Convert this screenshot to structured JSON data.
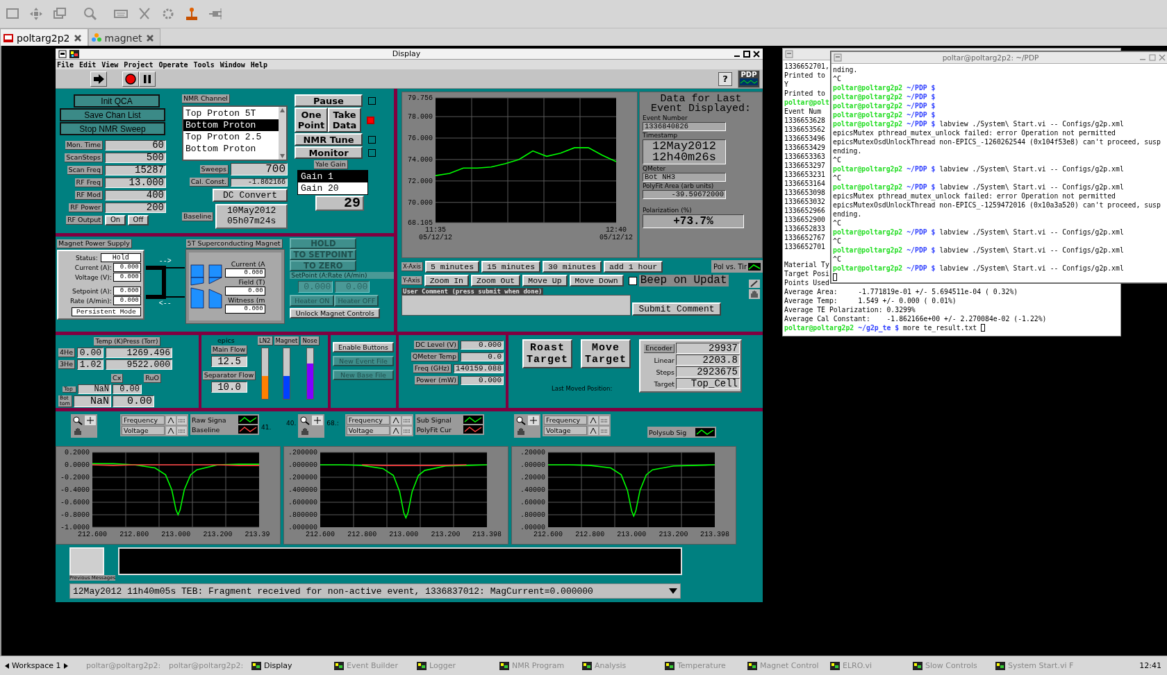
{
  "tabs": [
    {
      "label": "poltarg2p2",
      "selected": true
    },
    {
      "label": "magnet",
      "selected": false
    }
  ],
  "display": {
    "title": "Display",
    "menu": [
      "File",
      "Edit",
      "View",
      "Project",
      "Operate",
      "Tools",
      "Window",
      "Help"
    ],
    "help": "?",
    "logo": "PDP",
    "nmr": {
      "buttons": [
        "Init QCA",
        "Save Chan List",
        "Stop NMR Sweep"
      ],
      "settings": [
        {
          "label": "Mon. Time",
          "value": "60"
        },
        {
          "label": "ScanSteps",
          "value": "500"
        },
        {
          "label": "Scan Freq",
          "value": "15287"
        },
        {
          "label": "RF Freq",
          "value": "13.000"
        },
        {
          "label": "RF Mod",
          "value": "400"
        },
        {
          "label": "RF Power",
          "value": "200"
        }
      ],
      "rf_output": {
        "label": "RF Output",
        "buttons": [
          "On",
          "Off"
        ]
      },
      "channel_label": "NMR Channel",
      "channels": [
        {
          "label": "Top Proton 5T",
          "selected": false
        },
        {
          "label": "Bottom Proton",
          "selected": true
        },
        {
          "label": "Top Proton 2.5",
          "selected": false
        },
        {
          "label": "Bottom Proton",
          "selected": false
        }
      ],
      "sweeps": {
        "label": "Sweeps",
        "value": "700"
      },
      "cal_const": {
        "label": "Cal. Const.",
        "value": "-1.862166"
      },
      "dc_convert": "DC Convert",
      "baseline": {
        "label": "Baseline",
        "value": "10May2012\n05h07m24s"
      },
      "actions": [
        {
          "buttons": [
            "Pause"
          ],
          "led_on": false
        },
        {
          "buttons": [
            "One Point",
            "Take Data"
          ],
          "led_on": true
        },
        {
          "buttons": [
            "NMR Tune"
          ],
          "led_on": false
        },
        {
          "buttons": [
            "Monitor"
          ],
          "led_on": false
        }
      ],
      "gain_label": "Yale Gain",
      "gains": [
        {
          "label": "Gain 1",
          "selected": true
        },
        {
          "label": "Gain 20",
          "selected": false
        }
      ],
      "gain_reading": "29"
    },
    "magnet_supply": {
      "label": "Magnet Power Supply",
      "status_label": "Status:",
      "status": "Hold",
      "readings": [
        {
          "label": "Current (A):",
          "value": "0.000"
        },
        {
          "label": "Voltage (V):",
          "value": "0.000"
        },
        {
          "label": "Setpoint (A):",
          "value": "0.000"
        },
        {
          "label": "Rate (A/min):",
          "value": "0.000"
        }
      ],
      "persistent_mode": "Persistent Mode",
      "arrows": [
        "-->",
        "<--"
      ]
    },
    "magnet": {
      "label": "5T Superconducting Magnet",
      "readings": [
        {
          "label": "Current (A",
          "value": "0.000"
        },
        {
          "label": "Field (T)",
          "value": "0.00"
        },
        {
          "label": "Witness (m",
          "value": "0.000"
        }
      ]
    },
    "magnet_controls": {
      "buttons": [
        {
          "label": "HOLD",
          "disabled": true
        },
        {
          "label": "TO SETPOINT",
          "disabled": true
        },
        {
          "label": "TO ZERO",
          "disabled": true
        }
      ],
      "setpoint_label": "SetPoint (A:Rate (A/min)",
      "setpoint_values": [
        "0.000",
        "0.00"
      ],
      "heater_buttons": [
        {
          "label": "Heater ON",
          "disabled": true
        },
        {
          "label": "Heater OFF",
          "disabled": true
        }
      ],
      "unlock": "Unlock Magnet Controls"
    },
    "pol_chart": {
      "chart_data": {
        "type": "line",
        "grid": true,
        "categories": [
          "11:35\n05/12/12",
          null,
          null,
          null,
          null,
          null,
          null,
          null,
          null,
          null,
          null,
          null,
          null,
          "12:40\n05/12/12"
        ],
        "ylim": [
          68.105,
          79.756
        ],
        "yticks": [
          {
            "value": 79.756,
            "label": "79.756"
          },
          {
            "value": 78,
            "label": "78.000"
          },
          {
            "value": 76,
            "label": "76.000"
          },
          {
            "value": 74,
            "label": "74.000"
          },
          {
            "value": 72,
            "label": "72.000"
          },
          {
            "value": 70,
            "label": "70.000"
          },
          {
            "value": 68.105,
            "label": "68.105"
          }
        ],
        "series": [
          {
            "name": "Pol vs. Tir",
            "color": "#00ff00",
            "values": [
              72.5,
              72.7,
              73.2,
              73.2,
              73.3,
              73.6,
              74.0,
              74.8,
              74.3,
              74.6,
              75.1,
              75.1,
              74.4,
              73.8
            ]
          }
        ]
      }
    },
    "x_axis": {
      "label": "X-Axis",
      "buttons": [
        "5 minutes",
        "15 minutes",
        "30 minutes",
        "add 1 hour"
      ]
    },
    "y_axis": {
      "label": "Y-Axis",
      "buttons": [
        "Zoom In",
        "Zoom Out",
        "Move Up",
        "Move Down"
      ]
    },
    "beep": {
      "label": "Beep on Updat",
      "checked": false
    },
    "comment": {
      "label": "User Comment (press submit when done)",
      "submit": "Submit Comment"
    },
    "last_event": {
      "title": "Data for Last Event Displayed:",
      "fields": [
        {
          "label": "Event Number",
          "value": "1336840826",
          "kind": "small"
        },
        {
          "label": "Timestamp",
          "value": "12May2012\n12h40m26s",
          "kind": "large"
        },
        {
          "label": "QMeter",
          "value": "Bot NH3",
          "kind": "small"
        },
        {
          "label": "PolyFit Area (arb units)",
          "value": "-39.59672000",
          "kind": "small"
        },
        {
          "label": "Polarization (%)",
          "value": "+73.7%",
          "kind": "large"
        }
      ]
    },
    "temps": {
      "label": "Temp (K)Press (Torr)",
      "rows": [
        {
          "label": "4He",
          "temp": "0.00",
          "press": "1269.496"
        },
        {
          "label": "3He",
          "temp": "1.02",
          "press": "9522.000"
        }
      ],
      "sensor_labels": [
        "Cx",
        "RuO"
      ],
      "sensors": [
        {
          "label": "Top",
          "cx": "NaN",
          "ruo": "0.00"
        },
        {
          "label": "Bottom",
          "cx": "NaN",
          "ruo": "0.00"
        }
      ]
    },
    "flow": {
      "title": "epics",
      "flows": [
        {
          "label": "Main Flow",
          "value": "12.5"
        },
        {
          "label": "Separator Flow",
          "value": "10.0"
        }
      ],
      "levels": [
        {
          "label": "LN2",
          "level": 0.45,
          "color": "#ff8000"
        },
        {
          "label": "Magnet",
          "level": 0.45,
          "color": "#0040ff"
        },
        {
          "label": "Nose",
          "level": 0.7,
          "color": "#8000ff"
        }
      ]
    },
    "file_buttons": [
      {
        "label": "Enable Buttons",
        "disabled": false
      },
      {
        "label": "New Event File",
        "disabled": true
      },
      {
        "label": "New Base File",
        "disabled": true
      }
    ],
    "microwave": [
      {
        "label": "DC Level (V)",
        "value": "0.000"
      },
      {
        "label": "QMeter Temp",
        "value": "0.0"
      },
      {
        "label": "Freq (GHz)",
        "value": "140159.088"
      },
      {
        "label": "Power (mW)",
        "value": "0.000"
      }
    ],
    "target": {
      "buttons": [
        "Roast Target",
        "Move Target"
      ],
      "caption": "Last Moved Position:",
      "positions": [
        {
          "label": "Encoder",
          "value": "29937"
        },
        {
          "label": "Linear",
          "value": "2203.8"
        },
        {
          "label": "Steps",
          "value": "2923675"
        },
        {
          "label": "Target",
          "value": "Top_Cell"
        }
      ]
    },
    "spectra": [
      {
        "scales": [
          "Frequency",
          "Voltage"
        ],
        "stray_texts": [
          "41."
        ],
        "chart_data": {
          "type": "line",
          "grid": true,
          "x": [
            212.6,
            212.7,
            212.8,
            212.9,
            212.95,
            212.98,
            213.0,
            213.01,
            213.02,
            213.04,
            213.07,
            213.1,
            213.2,
            213.3,
            213.398
          ],
          "xlim": [
            212.6,
            213.398
          ],
          "ylim": [
            -1.0,
            0.2
          ],
          "xticks": [
            {
              "value": 212.6,
              "label": "212.600"
            },
            {
              "value": 212.8,
              "label": "212.800"
            },
            {
              "value": 213.0,
              "label": "213.000"
            },
            {
              "value": 213.2,
              "label": "213.200"
            },
            {
              "value": 213.39,
              "label": "213.39"
            }
          ],
          "yticks": [
            {
              "value": 0.2,
              "label": "0.2000"
            },
            {
              "value": 0,
              "label": "0.0000"
            },
            {
              "value": -0.2,
              "label": "-0.2000"
            },
            {
              "value": -0.4,
              "label": "-0.4000"
            },
            {
              "value": -0.6,
              "label": "-0.6000"
            },
            {
              "value": -0.8,
              "label": "-0.8000"
            },
            {
              "value": -1.0,
              "label": "-1.0000"
            }
          ],
          "series": [
            {
              "name": "Raw Signa",
              "color": "#00ff00",
              "values": [
                0.02,
                0.02,
                0.0,
                -0.05,
                -0.16,
                -0.4,
                -0.72,
                -0.8,
                -0.72,
                -0.4,
                -0.16,
                -0.08,
                0.0,
                0.01,
                0.01
              ]
            },
            {
              "name": "Baseline",
              "color": "#ff4040",
              "values": [
                0.0,
                -0.01,
                0.0,
                0.0,
                0.0,
                0.0,
                0.0,
                0.0,
                0.0,
                0.0,
                0.0,
                0.0,
                0.0,
                -0.01,
                -0.01
              ]
            }
          ]
        }
      },
      {
        "scales": [
          "Frequency",
          "Voltage"
        ],
        "stray_texts": [
          "40.",
          "68.:"
        ],
        "bottom_tick_label": ".000000",
        "chart_data": {
          "type": "line",
          "grid": true,
          "x": [
            212.6,
            212.7,
            212.8,
            212.9,
            212.95,
            212.98,
            213.0,
            213.01,
            213.02,
            213.04,
            213.07,
            213.1,
            213.2,
            213.3,
            213.398
          ],
          "xlim": [
            212.6,
            213.398
          ],
          "ylim": [
            -1.0,
            0.2
          ],
          "xticks": [
            {
              "value": 212.6,
              "label": "212.600"
            },
            {
              "value": 212.8,
              "label": "212.800"
            },
            {
              "value": 213.0,
              "label": "213.000"
            },
            {
              "value": 213.2,
              "label": "213.200"
            },
            {
              "value": 213.398,
              "label": "213.398"
            }
          ],
          "yticks": [
            {
              "value": 0.2,
              "label": ".200000"
            },
            {
              "value": 0,
              "label": ".000000"
            },
            {
              "value": -0.2,
              "label": ".200000"
            },
            {
              "value": -0.4,
              "label": ".400000"
            },
            {
              "value": -0.6,
              "label": ".600000"
            },
            {
              "value": -0.8,
              "label": ".800000"
            }
          ],
          "series": [
            {
              "name": "Sub Signal",
              "color": "#00ff00",
              "values": [
                0.0,
                0.0,
                -0.01,
                -0.06,
                -0.17,
                -0.43,
                -0.77,
                -0.85,
                -0.77,
                -0.43,
                -0.17,
                -0.09,
                -0.02,
                -0.01,
                0.0
              ]
            },
            {
              "name": "PolyFit Cur",
              "color": "#ff4040",
              "values": [
                null,
                null,
                0.0,
                -0.01,
                -0.01,
                -0.01,
                -0.01,
                -0.01,
                -0.01,
                -0.01,
                -0.01,
                -0.01,
                -0.01,
                0.0,
                null
              ]
            }
          ]
        }
      },
      {
        "scales": [
          "Frequency",
          "Voltage"
        ],
        "bottom_tick_label": ".00000",
        "chart_data": {
          "type": "line",
          "grid": true,
          "x": [
            212.6,
            212.7,
            212.8,
            212.9,
            212.95,
            212.98,
            213.0,
            213.01,
            213.02,
            213.04,
            213.07,
            213.1,
            213.2,
            213.3,
            213.398
          ],
          "xlim": [
            212.6,
            213.398
          ],
          "ylim": [
            -1.0,
            0.2
          ],
          "xticks": [
            {
              "value": 212.6,
              "label": "212.600"
            },
            {
              "value": 212.8,
              "label": "212.800"
            },
            {
              "value": 213.0,
              "label": "213.000"
            },
            {
              "value": 213.2,
              "label": "213.200"
            },
            {
              "value": 213.398,
              "label": "213.398"
            }
          ],
          "yticks": [
            {
              "value": 0.2,
              "label": ".20000"
            },
            {
              "value": 0,
              "label": ".00000"
            },
            {
              "value": -0.2,
              "label": ".20000"
            },
            {
              "value": -0.4,
              "label": ".40000"
            },
            {
              "value": -0.6,
              "label": ".60000"
            },
            {
              "value": -0.8,
              "label": ".80000"
            }
          ],
          "series": [
            {
              "name": "Polysub Sig",
              "color": "#00ff00",
              "values": [
                0.0,
                0.0,
                -0.01,
                -0.05,
                -0.16,
                -0.41,
                -0.74,
                -0.82,
                -0.74,
                -0.41,
                -0.16,
                -0.08,
                -0.02,
                -0.01,
                0.0
              ]
            }
          ]
        }
      }
    ],
    "messages": {
      "button": "Previous Messages",
      "status": "12May2012 11h40m05s TEB: Fragment received for non-active event, 1336837012: MagCurrent=0.000000"
    }
  },
  "terminals": [
    {
      "lines": [
        {
          "kind": "out",
          "text": "1336652701,"
        },
        {
          "kind": "out",
          "text": "Printed to"
        },
        {
          "kind": "out",
          "text": "Y"
        },
        {
          "kind": "out",
          "text": "Printed to"
        },
        {
          "kind": "prompt",
          "user": "poltar@polt"
        },
        {
          "kind": "out",
          "text": "Event Num"
        },
        {
          "kind": "out",
          "text": "1336653628"
        },
        {
          "kind": "out",
          "text": "1336653562"
        },
        {
          "kind": "out",
          "text": "1336653496"
        },
        {
          "kind": "out",
          "text": "1336653429"
        },
        {
          "kind": "out",
          "text": "1336653363"
        },
        {
          "kind": "out",
          "text": "1336653297"
        },
        {
          "kind": "out",
          "text": "1336653231"
        },
        {
          "kind": "out",
          "text": "1336653164"
        },
        {
          "kind": "out",
          "text": "1336653098"
        },
        {
          "kind": "out",
          "text": "1336653032"
        },
        {
          "kind": "out",
          "text": "1336652966"
        },
        {
          "kind": "out",
          "text": "1336652900"
        },
        {
          "kind": "out",
          "text": "1336652833"
        },
        {
          "kind": "out",
          "text": "1336652767"
        },
        {
          "kind": "out",
          "text": "1336652701"
        },
        {
          "kind": "blank"
        },
        {
          "kind": "out",
          "text": "Material Ty"
        },
        {
          "kind": "out",
          "text": "Target Posi"
        },
        {
          "kind": "out",
          "text": "Points Used"
        },
        {
          "kind": "out",
          "text": "Average Area:     -1.771819e-01 +/- 5.694511e-04 ( 0.32%)"
        },
        {
          "kind": "out",
          "text": "Average Temp:     1.549 +/- 0.000 ( 0.01%)"
        },
        {
          "kind": "out",
          "text": "Average TE Polarization: 0.3299%"
        },
        {
          "kind": "out",
          "text": "Average Cal Constant:    -1.862166e+00 +/- 2.270084e-02 (-1.22%)"
        },
        {
          "kind": "prompt",
          "user": "poltar@poltarg2p2",
          "path": "~/g2p_te $",
          "text": "more te_result.txt",
          "cursor": true
        }
      ]
    },
    {
      "title": "poltar@poltarg2p2: ~/PDP",
      "lines": [
        {
          "kind": "out",
          "text": "nding."
        },
        {
          "kind": "out",
          "text": "^C"
        },
        {
          "kind": "prompt",
          "user": "poltar@poltarg2p2",
          "path": "~/PDP $"
        },
        {
          "kind": "prompt",
          "user": "poltar@poltarg2p2",
          "path": "~/PDP $"
        },
        {
          "kind": "prompt",
          "user": "poltar@poltarg2p2",
          "path": "~/PDP $"
        },
        {
          "kind": "prompt",
          "user": "poltar@poltarg2p2",
          "path": "~/PDP $"
        },
        {
          "kind": "prompt",
          "user": "poltar@poltarg2p2",
          "path": "~/PDP $",
          "text": "labview ./System\\ Start.vi -- Configs/g2p.xml"
        },
        {
          "kind": "out",
          "text": "epicsMutex pthread_mutex_unlock failed: error Operation not permitted"
        },
        {
          "kind": "out",
          "text": "epicsMutexOsdUnlockThread non-EPICS_-1260262544 (0x104f53e8) can't proceed, susp"
        },
        {
          "kind": "out",
          "text": "ending."
        },
        {
          "kind": "out",
          "text": "^C"
        },
        {
          "kind": "prompt",
          "user": "poltar@poltarg2p2",
          "path": "~/PDP $",
          "text": "labview ./System\\ Start.vi -- Configs/g2p.xml"
        },
        {
          "kind": "out",
          "text": "^C"
        },
        {
          "kind": "prompt",
          "user": "poltar@poltarg2p2",
          "path": "~/PDP $",
          "text": "labview ./System\\ Start.vi -- Configs/g2p.xml"
        },
        {
          "kind": "out",
          "text": "epicsMutex pthread_mutex_unlock failed: error Operation not permitted"
        },
        {
          "kind": "out",
          "text": "epicsMutexOsdUnlockThread non-EPICS_-1259472016 (0x10a3a520) can't proceed, susp"
        },
        {
          "kind": "out",
          "text": "ending."
        },
        {
          "kind": "out",
          "text": "^C"
        },
        {
          "kind": "prompt",
          "user": "poltar@poltarg2p2",
          "path": "~/PDP $",
          "text": "labview ./System\\ Start.vi -- Configs/g2p.xml"
        },
        {
          "kind": "out",
          "text": "^C"
        },
        {
          "kind": "prompt",
          "user": "poltar@poltarg2p2",
          "path": "~/PDP $",
          "text": "labview ./System\\ Start.vi -- Configs/g2p.xml"
        },
        {
          "kind": "out",
          "text": "^C"
        },
        {
          "kind": "prompt",
          "user": "poltar@poltarg2p2",
          "path": "~/PDP $",
          "text": "labview ./System\\ Start.vi -- Configs/g2p.xml"
        },
        {
          "kind": "cursor"
        }
      ]
    }
  ],
  "taskbar": {
    "workspace": "Workspace 1",
    "items": [
      {
        "label": "poltar@poltarg2p2:",
        "kind": "terminal",
        "selected": false
      },
      {
        "label": "poltar@poltarg2p2:",
        "kind": "terminal",
        "selected": false
      },
      {
        "label": "Display",
        "kind": "labview",
        "selected": true
      },
      {
        "label": "Event Builder",
        "kind": "labview",
        "selected": false
      },
      {
        "label": "Logger",
        "kind": "labview",
        "selected": false
      },
      {
        "label": "NMR Program",
        "kind": "labview",
        "selected": false
      },
      {
        "label": "Analysis",
        "kind": "labview",
        "selected": false
      },
      {
        "label": "Temperature",
        "kind": "labview",
        "selected": false
      },
      {
        "label": "Magnet Control",
        "kind": "labview",
        "selected": false
      },
      {
        "label": "ELRO.vi",
        "kind": "labview",
        "selected": false
      },
      {
        "label": "Slow Controls",
        "kind": "labview",
        "selected": false
      },
      {
        "label": "System Start.vi F",
        "kind": "labview",
        "selected": false
      }
    ],
    "clock": "12:41"
  }
}
